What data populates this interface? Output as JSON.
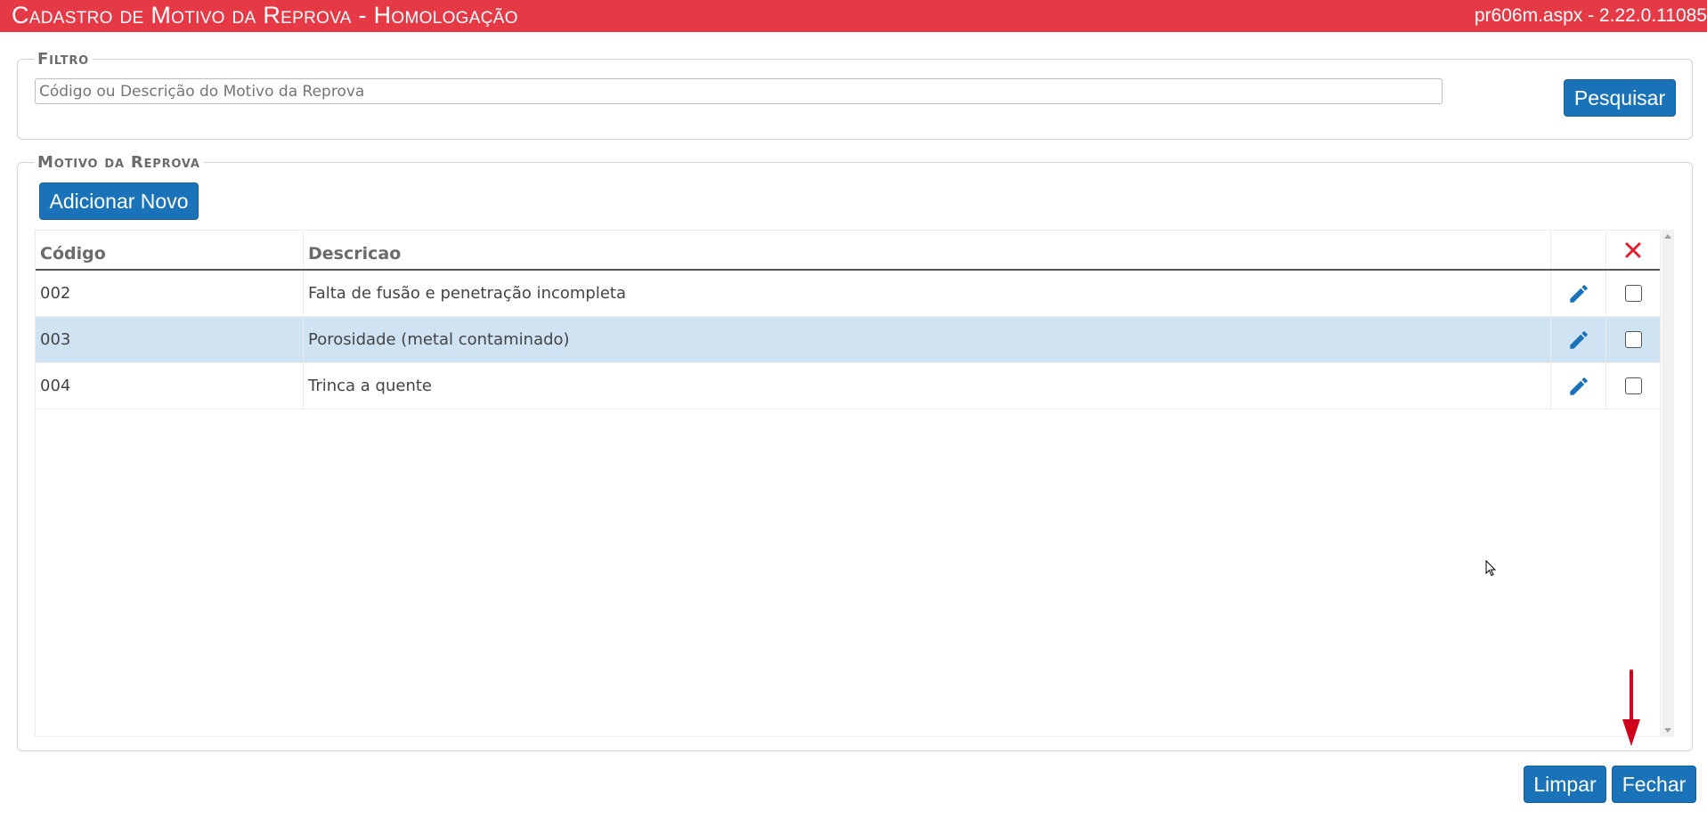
{
  "titlebar": {
    "title": "Cadastro de Motivo da Reprova  - Homologação",
    "version": "pr606m.aspx - 2.22.0.11085",
    "color": "#e63946"
  },
  "filtro": {
    "legend": "Filtro",
    "search_placeholder": "Código ou Descrição do Motivo da Reprova",
    "search_button": "Pesquisar"
  },
  "motivo": {
    "legend": "Motivo da Reprova",
    "add_button": "Adicionar Novo",
    "columns": {
      "codigo": "Código",
      "descricao": "Descricao",
      "edit_icon": "pencil-icon",
      "delete_icon": "close-icon"
    },
    "rows": [
      {
        "codigo": "002",
        "descricao": "Falta de fusão e penetração incompleta",
        "checked": false,
        "selected": false
      },
      {
        "codigo": "003",
        "descricao": "Porosidade (metal contaminado)",
        "checked": false,
        "selected": true
      },
      {
        "codigo": "004",
        "descricao": "Trinca a quente",
        "checked": false,
        "selected": false
      }
    ]
  },
  "footer": {
    "limpar": "Limpar",
    "fechar": "Fechar"
  },
  "colors": {
    "accent": "#1a73b8",
    "selected_row": "#cfe3f3",
    "delete": "#e0202e",
    "annotation_arrow": "#d0021b"
  }
}
